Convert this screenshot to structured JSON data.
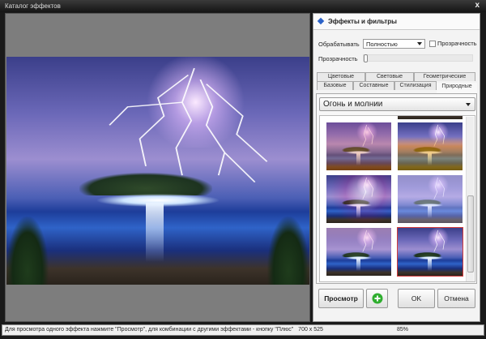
{
  "window": {
    "title": "Каталог эффектов",
    "close_label": "x"
  },
  "panel": {
    "header": "Эффекты и фильтры",
    "process_label": "Обрабатывать",
    "process_value": "Полностью",
    "transparency_checkbox_label": "Прозрачность",
    "transparency_checked": false,
    "transparency_slider_label": "Прозрачность",
    "transparency_value": 0,
    "tabs_row1": [
      "Цветовые",
      "Световые",
      "Геометрические"
    ],
    "tabs_row2": [
      "Базовые",
      "Составные",
      "Стилизация",
      "Природные"
    ],
    "active_tab": "Природные",
    "category_value": "Огонь и молнии",
    "selected_thumbnail": 6
  },
  "buttons": {
    "preview": "Просмотр",
    "plus_icon": "plus-circle-icon",
    "ok": "OK",
    "cancel": "Отмена"
  },
  "status": {
    "hint": "Для просмотра одного эффекта нажмите \"Просмотр\", для комбинации с другими эффектами - кнопку \"Плюс\"",
    "size": "700 x 525",
    "zoom": "85%"
  },
  "colors": {
    "selection": "#d43a3a",
    "plus": "#2fae2f"
  }
}
